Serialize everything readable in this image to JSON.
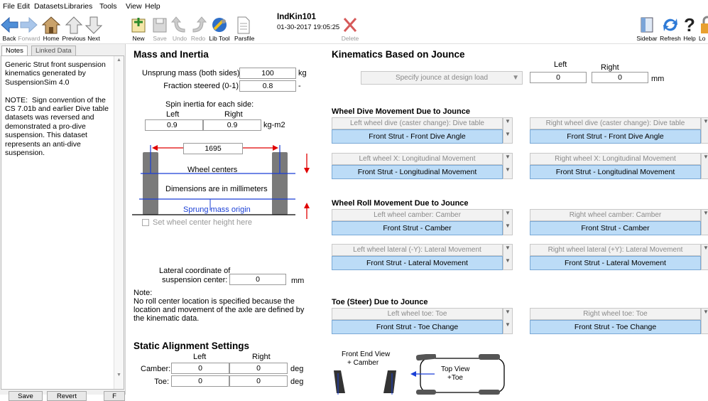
{
  "menu": [
    "File",
    "Edit",
    "Datasets",
    "Libraries",
    "Tools",
    "View",
    "Help"
  ],
  "toolbar": {
    "back": "Back",
    "forward": "Forward",
    "home": "Home",
    "previous": "Previous",
    "next": "Next",
    "new": "New",
    "save": "Save",
    "undo": "Undo",
    "redo": "Redo",
    "libtool": "Lib Tool",
    "parsfile": "Parsfile",
    "delete": "Delete",
    "sidebar": "Sidebar",
    "refresh": "Refresh",
    "help": "Help",
    "lock": "Lo"
  },
  "dataset": {
    "name": "IndKin101",
    "date": "01-30-2017 19:05:25"
  },
  "sidepanel": {
    "tabs": [
      "Notes",
      "Linked Data"
    ],
    "notes": "Generic Strut front suspension kinematics generated by SuspensionSim 4.0\n\nNOTE:  Sign convention of the CS 7.01b and earlier Dive table datasets was reversed and demonstrated a pro-dive suspension. This dataset represents an anti-dive suspension.",
    "buttons": [
      "Save",
      "Revert",
      "F"
    ]
  },
  "mass": {
    "title": "Mass and Inertia",
    "unsprung_label": "Unsprung mass (both sides):",
    "unsprung_value": "100",
    "unsprung_unit": "kg",
    "steered_label": "Fraction steered (0-1)",
    "steered_value": "0.8",
    "steered_unit": "-",
    "spin_title": "Spin inertia for each side:",
    "left": "Left",
    "right": "Right",
    "spin_left": "0.9",
    "spin_right": "0.9",
    "spin_unit": "kg-m2"
  },
  "diagram": {
    "track_width": "1695",
    "wheel_centers": "Wheel centers",
    "dimensions": "Dimensions are in millimeters",
    "sprung_origin": "Sprung mass origin",
    "set_height": "Set wheel center height here"
  },
  "lateral": {
    "label1": "Lateral coordinate of",
    "label2": "suspension center:",
    "value": "0",
    "unit": "mm"
  },
  "note": {
    "title": "Note:",
    "text": "No roll center location is specified because the location and movement of the axle are defined by the kinematic data."
  },
  "static": {
    "title": "Static Alignment Settings",
    "left": "Left",
    "right": "Right",
    "camber_label": "Camber:",
    "camber_left": "0",
    "camber_right": "0",
    "toe_label": "Toe:",
    "toe_left": "0",
    "toe_right": "0",
    "unit": "deg"
  },
  "kin": {
    "title": "Kinematics Based on Jounce",
    "jounce_select": "Specify jounce at design load",
    "left": "Left",
    "right": "Right",
    "left_value": "0",
    "right_value": "0",
    "unit": "mm"
  },
  "dive": {
    "title": "Wheel Dive Movement Due to Jounce",
    "left_header": "Left wheel dive (caster change): Dive table",
    "left_value": "Front Strut - Front Dive Angle",
    "right_header": "Right wheel dive (caster change): Dive table",
    "right_value": "Front Strut - Front Dive Angle",
    "leftx_header": "Left wheel X: Longitudinal Movement",
    "leftx_value": "Front Strut -  Longitudinal Movement",
    "rightx_header": "Right wheel X: Longitudinal Movement",
    "rightx_value": "Front Strut -  Longitudinal Movement"
  },
  "roll": {
    "title": "Wheel Roll Movement Due to Jounce",
    "left_header": "Left wheel camber: Camber",
    "left_value": "Front Strut - Camber",
    "right_header": "Right wheel camber: Camber",
    "right_value": "Front Strut - Camber",
    "leftl_header": "Left wheel lateral (-Y): Lateral Movement",
    "leftl_value": "Front Strut - Lateral Movement",
    "rightl_header": "Right wheel lateral (+Y): Lateral Movement",
    "rightl_value": "Front Strut - Lateral Movement"
  },
  "toe": {
    "title": "Toe (Steer) Due to Jounce",
    "left_header": "Left wheel toe: Toe",
    "left_value": "Front Strut -  Toe Change",
    "right_header": "Right wheel toe: Toe",
    "right_value": "Front Strut -  Toe Change"
  },
  "views": {
    "front_view": "Front End View",
    "plus_camber": "+ Camber",
    "top_view": "Top View",
    "plus_toe": "+Toe"
  },
  "colors": {
    "accent_blue": "#bcdcf7",
    "arrow_red": "#e00000",
    "line_blue": "#1a3fd6"
  }
}
